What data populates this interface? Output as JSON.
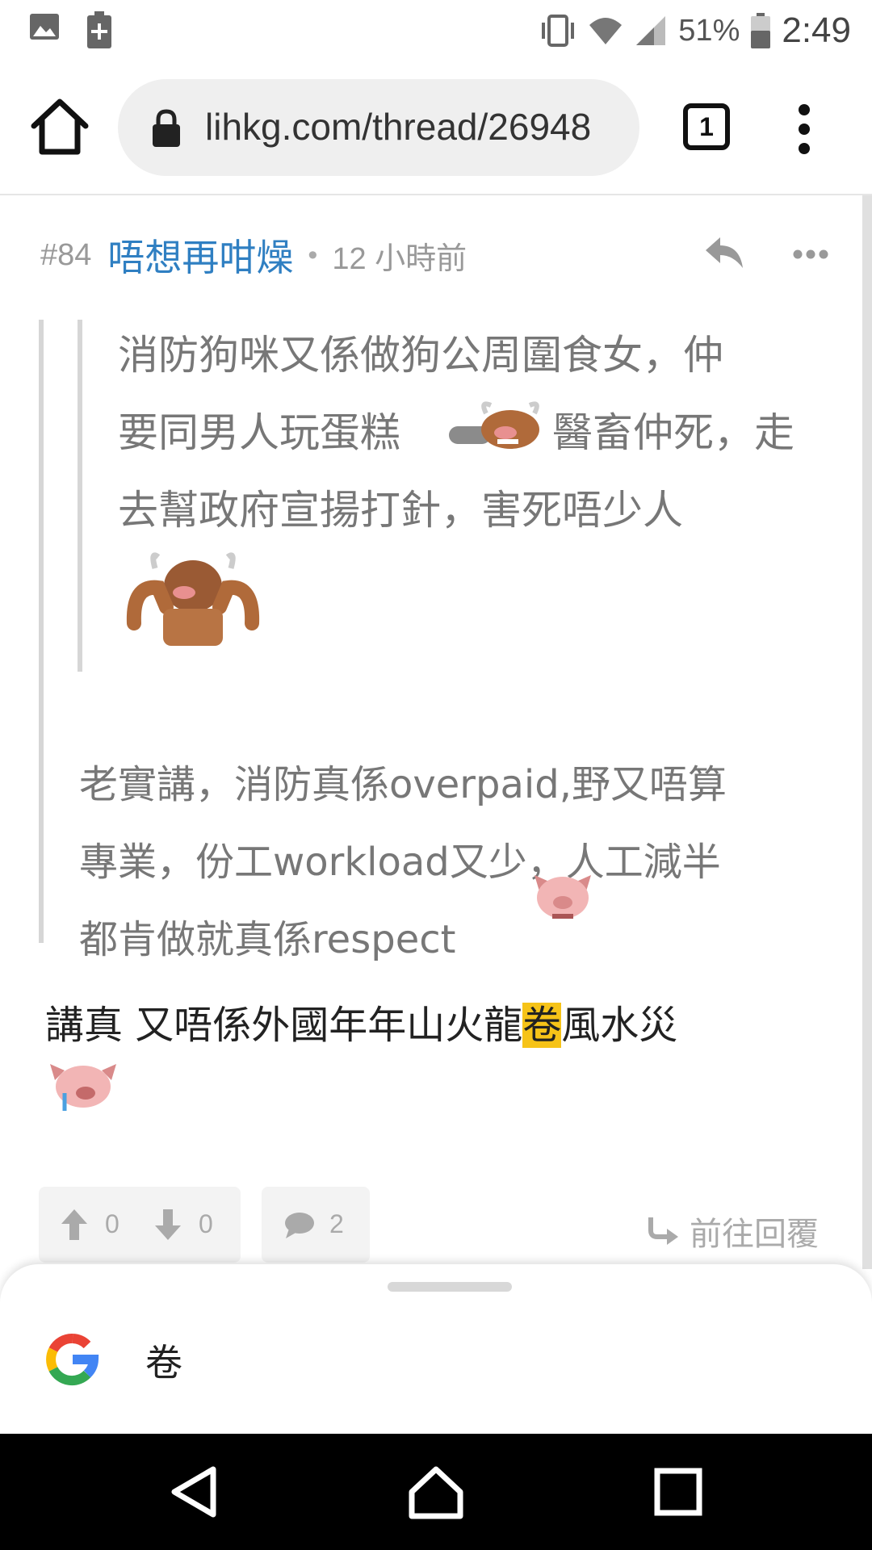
{
  "status_bar": {
    "battery": "51%",
    "time": "2:49",
    "icons": [
      "image-icon",
      "battery-saver-icon",
      "vibrate-icon",
      "wifi-icon",
      "signal-icon",
      "battery-icon"
    ]
  },
  "browser": {
    "url": "lihkg.com/thread/26948",
    "tab_count": "1",
    "icons": [
      "home-icon",
      "lock-icon",
      "tabs-icon",
      "menu-icon"
    ]
  },
  "post": {
    "number": "#84",
    "username": "唔想再咁燥",
    "separator": "•",
    "time": "12 小時前",
    "nested_quote": {
      "line1": "消防狗咪又係做狗公周圍食女，仲",
      "line2a": "要同男人玩蛋糕",
      "line2b": "醫畜仲死，走",
      "line3": "去幫政府宣揚打針，害死唔少人"
    },
    "quote": {
      "line1": "老實講，消防真係overpaid,野又唔算",
      "line2": "專業，份工workload又少，人工減半",
      "line3": "都肯做就真係respect"
    },
    "reply": {
      "before": "講真 又唔係外國年年山火龍",
      "highlight": "卷",
      "after": "風水災"
    },
    "upvotes": "0",
    "downvotes": "0",
    "comments": "2",
    "goto_reply": "前往回覆"
  },
  "search_sheet": {
    "query": "卷"
  },
  "colors": {
    "username": "#2f7fc2",
    "highlight": "#f6c318",
    "muted": "#999999"
  }
}
